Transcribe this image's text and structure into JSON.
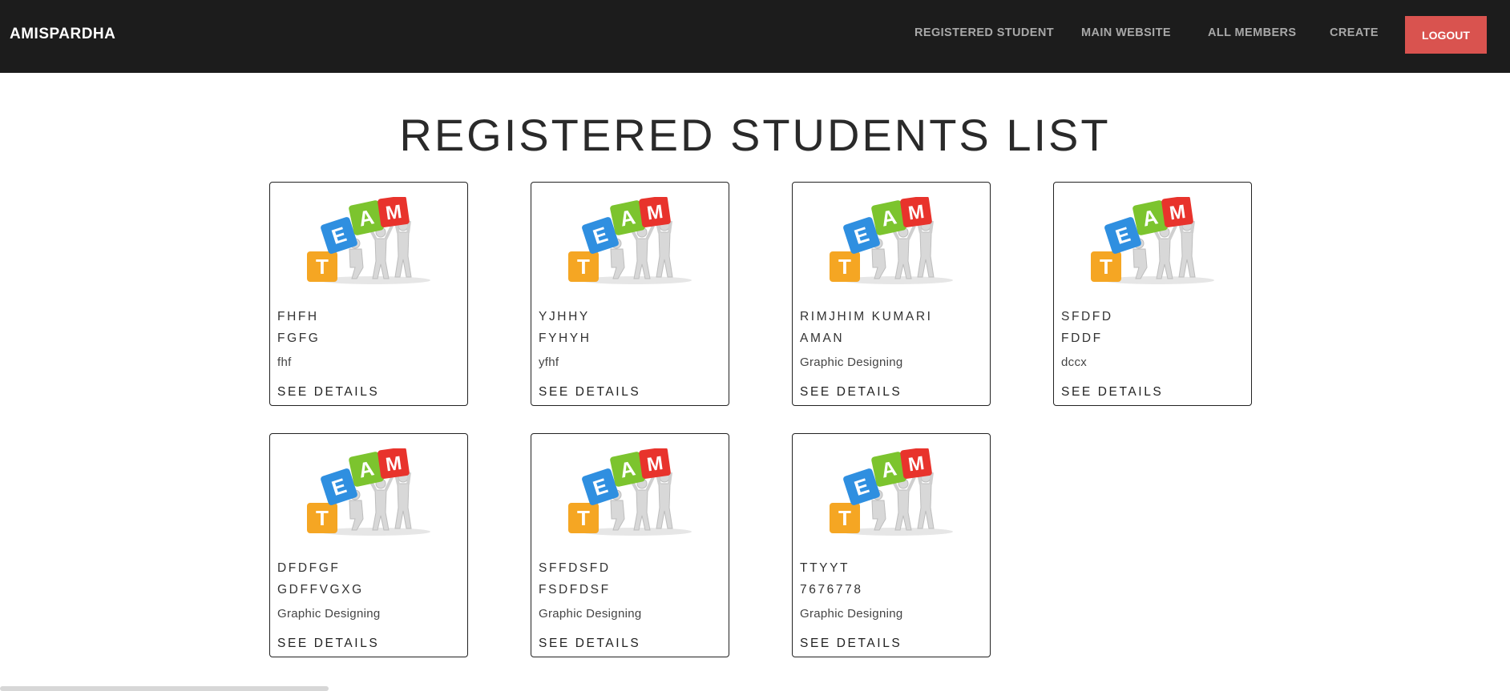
{
  "navbar": {
    "brand": "AMISPARDHA",
    "links": [
      {
        "label": "REGISTERED STUDENT"
      },
      {
        "label": "MAIN WEBSITE"
      },
      {
        "label": "ALL MEMBERS"
      },
      {
        "label": "CREATE"
      }
    ],
    "logout_label": "LOGOUT",
    "logout_color": "#d9534f"
  },
  "page": {
    "title": "REGISTERED STUDENTS LIST"
  },
  "cards": [
    {
      "line1": "FHFH",
      "line2": "FGFG",
      "course": "fhf",
      "details_label": "SEE DETAILS"
    },
    {
      "line1": "YJHHY",
      "line2": "FYHYH",
      "course": "yfhf",
      "details_label": "SEE DETAILS"
    },
    {
      "line1": "RIMJHIM KUMARI",
      "line2": "AMAN",
      "course": "Graphic Designing",
      "details_label": "SEE DETAILS"
    },
    {
      "line1": "SFDFD",
      "line2": "FDDF",
      "course": "dccx",
      "details_label": "SEE DETAILS"
    },
    {
      "line1": "DFDFGF",
      "line2": "GDFFVGXG",
      "course": "Graphic Designing",
      "details_label": "SEE DETAILS"
    },
    {
      "line1": "SFFDSFD",
      "line2": "FSDFDSF",
      "course": "Graphic Designing",
      "details_label": "SEE DETAILS"
    },
    {
      "line1": "TTYYT",
      "line2": "7676778",
      "course": "Graphic Designing",
      "details_label": "SEE DETAILS"
    }
  ],
  "team_image": {
    "icon": "team-blocks-illustration",
    "letters": [
      "T",
      "E",
      "A",
      "M"
    ],
    "colors": [
      "#f5a623",
      "#2f8fe0",
      "#7cc42e",
      "#e8332c"
    ]
  }
}
